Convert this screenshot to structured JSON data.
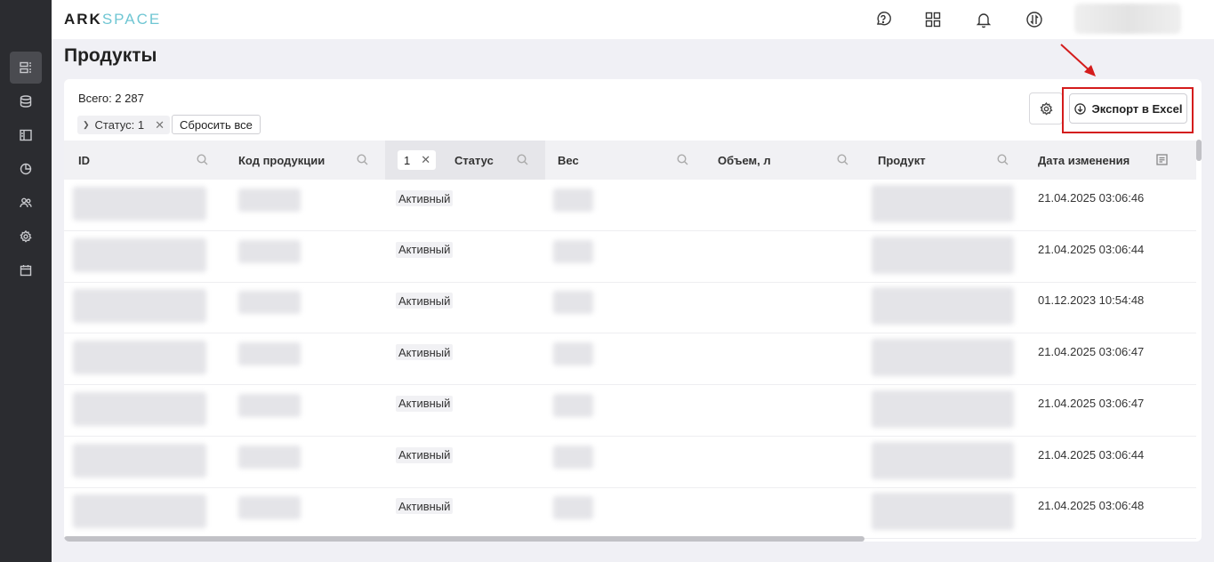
{
  "app": {
    "logo_part1": "ARK",
    "logo_part2": "SPACE"
  },
  "sidebar": {
    "items": [
      {
        "name": "products",
        "icon": "products-list-icon",
        "active": true
      },
      {
        "name": "database",
        "icon": "database-icon"
      },
      {
        "name": "layout",
        "icon": "layout-icon"
      },
      {
        "name": "analytics",
        "icon": "pie-chart-icon"
      },
      {
        "name": "users",
        "icon": "users-icon"
      },
      {
        "name": "settings",
        "icon": "gear-icon"
      },
      {
        "name": "calendar",
        "icon": "calendar-icon"
      }
    ]
  },
  "topbar": {
    "icons": [
      "help-chat-icon",
      "apps-grid-icon",
      "bell-icon",
      "sync-icon"
    ]
  },
  "page": {
    "title": "Продукты"
  },
  "toolbar": {
    "total": "Всего: 2 287",
    "filter_chip": "Статус: 1",
    "reset_label": "Сбросить все",
    "export_label": "Экспорт в Excel"
  },
  "table": {
    "columns": {
      "id": "ID",
      "code": "Код продукции",
      "status_filter": "1",
      "status": "Статус",
      "weight": "Вес",
      "volume": "Объем, л",
      "product": "Продукт",
      "modified": "Дата изменения"
    },
    "rows": [
      {
        "status": "Активный",
        "modified": "21.04.2025 03:06:46"
      },
      {
        "status": "Активный",
        "modified": "21.04.2025 03:06:44"
      },
      {
        "status": "Активный",
        "modified": "01.12.2023 10:54:48"
      },
      {
        "status": "Активный",
        "modified": "21.04.2025 03:06:47"
      },
      {
        "status": "Активный",
        "modified": "21.04.2025 03:06:47"
      },
      {
        "status": "Активный",
        "modified": "21.04.2025 03:06:44"
      },
      {
        "status": "Активный",
        "modified": "21.04.2025 03:06:48"
      }
    ]
  },
  "colors": {
    "sidebar_bg": "#2b2c30",
    "accent_logo": "#6fc6d3",
    "highlight_red": "#d41c1c",
    "page_bg": "#f0f0f5"
  }
}
